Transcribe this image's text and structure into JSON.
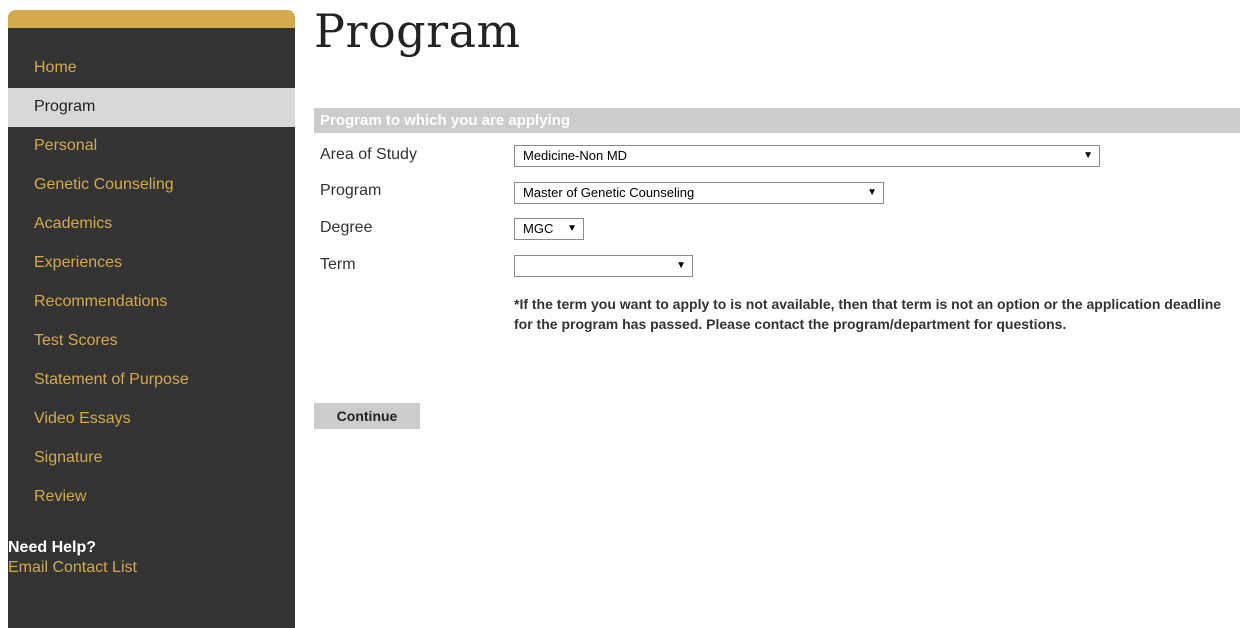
{
  "sidebar": {
    "items": [
      {
        "label": "Home"
      },
      {
        "label": "Program"
      },
      {
        "label": "Personal"
      },
      {
        "label": "Genetic Counseling"
      },
      {
        "label": "Academics"
      },
      {
        "label": "Experiences"
      },
      {
        "label": "Recommendations"
      },
      {
        "label": "Test Scores"
      },
      {
        "label": "Statement of Purpose"
      },
      {
        "label": "Video Essays"
      },
      {
        "label": "Signature"
      },
      {
        "label": "Review"
      }
    ],
    "active_item": "Program",
    "help_title": "Need Help?",
    "help_link": "Email Contact List"
  },
  "page": {
    "title": "Program"
  },
  "form": {
    "section_header": "Program to which you are applying",
    "area_of_study": {
      "label": "Area of Study",
      "value": "Medicine-Non MD"
    },
    "program": {
      "label": "Program",
      "value": "Master of Genetic Counseling"
    },
    "degree": {
      "label": "Degree",
      "value": "MGC"
    },
    "term": {
      "label": "Term",
      "value": ""
    },
    "note": "*If the term you want to apply to is not available, then that term is not an option or the application deadline for the program has passed. Please contact the program/department for questions.",
    "continue_label": "Continue"
  },
  "icons": {
    "dropdown_arrow": "▼"
  },
  "colors": {
    "sidebar_bg": "#333333",
    "accent_gold": "#d4aa4d",
    "active_item_bg": "#d8d8d8",
    "section_header_bg": "#cccccc",
    "button_bg": "#cccccc"
  }
}
